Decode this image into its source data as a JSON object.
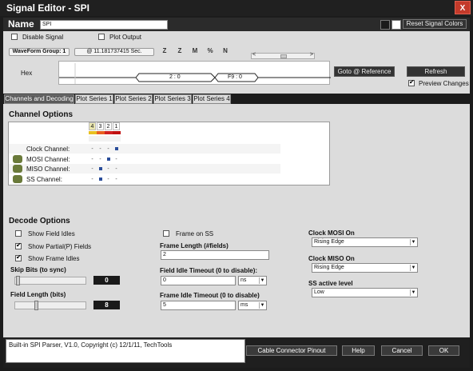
{
  "window": {
    "title": "Signal Editor - SPI",
    "close": "X"
  },
  "name_row": {
    "label": "Name",
    "value": "SPI",
    "reset_colors": "Reset Signal Colors"
  },
  "top": {
    "disable_signal": "Disable Signal",
    "plot_output": "Plot Output",
    "waveform_group": "WaveForm Group: 1",
    "time": "@ 11.181737415 Sec.",
    "tool_icons": [
      "Z",
      "Z",
      "M",
      "%",
      "N"
    ],
    "hex_label": "Hex",
    "hex_values": [
      "2 : 0",
      "F9 : 0"
    ],
    "goto_ref": "Goto @ Reference",
    "refresh": "Refresh",
    "preview_changes": "Preview Changes"
  },
  "tabs": [
    "Channels and Decoding",
    "Plot Series 1",
    "Plot Series 2",
    "Plot Series 3",
    "Plot Series 4"
  ],
  "channel_options": {
    "title": "Channel Options",
    "columns": [
      "4",
      "3",
      "2",
      "1"
    ],
    "dash": "-",
    "rows": [
      "Clock Channel:",
      "MOSI Channel:",
      "MISO Channel:",
      "SS Channel:"
    ]
  },
  "decode": {
    "title": "Decode Options",
    "show_field_idles": "Show Field Idles",
    "show_partial": "Show Partial(P) Fields",
    "show_frame_idles": "Show Frame Idles",
    "skip_bits_label": "Skip Bits (to sync)",
    "skip_bits_value": "0",
    "field_length_label": "Field Length (bits)",
    "field_length_value": "8",
    "frame_on_ss": "Frame on SS",
    "frame_length_label": "Frame Length (#fields)",
    "frame_length_value": "2",
    "field_idle_label": "Field Idle Timeout (0 to disable):",
    "field_idle_value": "0",
    "field_idle_unit": "ns",
    "frame_idle_label": "Frame Idle Timeout (0 to disable)",
    "frame_idle_value": "5",
    "frame_idle_unit": "ms",
    "clock_mosi_label": "Clock MOSI On",
    "clock_mosi_value": "Rising Edge",
    "clock_miso_label": "Clock MISO On",
    "clock_miso_value": "Rising Edge",
    "ss_active_label": "SS active level",
    "ss_active_value": "Low"
  },
  "status_text": "Built-in SPI Parser, V1.0, Copyright (c) 12/1/11, TechTools",
  "buttons": {
    "cable": "Cable Connector Pinout",
    "help": "Help",
    "cancel": "Cancel",
    "ok": "OK"
  },
  "colors": {
    "ch4": "#e8c020",
    "ch3": "#e86020",
    "ch2": "#d02020",
    "ch1": "#c01010"
  }
}
